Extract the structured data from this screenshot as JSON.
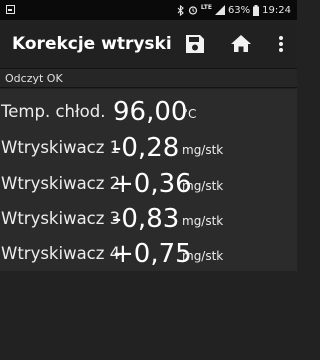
{
  "status_bar": {
    "battery": "63%",
    "time": "19:24",
    "network": "LTE"
  },
  "app_bar": {
    "title": "Korekcje wtryskiw...",
    "icons": [
      "save-icon",
      "home-icon",
      "overflow-menu-icon"
    ]
  },
  "read_status": "Odczyt OK",
  "rows": [
    {
      "label": "Temp. chłod.",
      "value": "96,00",
      "unit": "°C"
    },
    {
      "label": "Wtryskiwacz 1",
      "value": "-0,28",
      "unit": "mg/stk"
    },
    {
      "label": "Wtryskiwacz 2",
      "value": "+0,36",
      "unit": "mg/stk"
    },
    {
      "label": "Wtryskiwacz 3",
      "value": "-0,83",
      "unit": "mg/stk"
    },
    {
      "label": "Wtryskiwacz 4",
      "value": "+0,75",
      "unit": "mg/stk"
    }
  ],
  "colors": {
    "background": "#222222",
    "panel": "#2b2b2b",
    "text": "#ffffff"
  }
}
